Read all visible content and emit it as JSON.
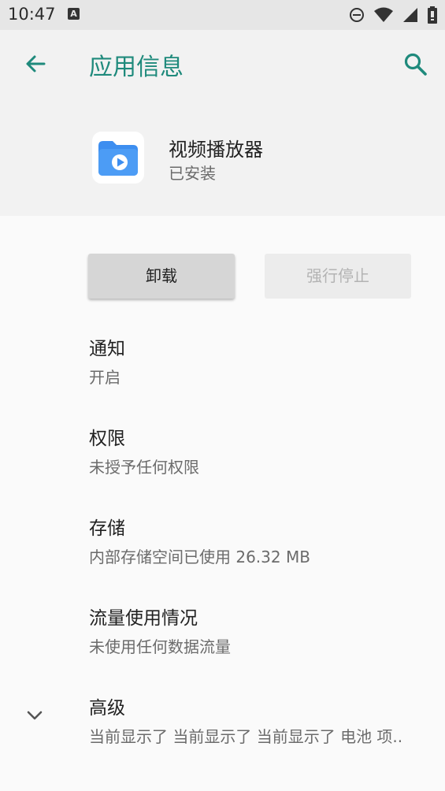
{
  "status_bar": {
    "time": "10:47",
    "notification_icon_letter": "A",
    "icons": [
      "dnd-icon",
      "wifi-icon",
      "signal-icon",
      "battery-icon"
    ]
  },
  "toolbar": {
    "title": "应用信息",
    "back_icon": "arrow-left-icon",
    "search_icon": "search-icon",
    "accent_color": "#1f8a7c"
  },
  "app": {
    "name": "视频播放器",
    "status": "已安装",
    "icon": "video-folder-icon"
  },
  "buttons": {
    "uninstall": "卸载",
    "force_stop": "强行停止"
  },
  "settings": [
    {
      "title": "通知",
      "subtitle": "开启"
    },
    {
      "title": "权限",
      "subtitle": "未授予任何权限"
    },
    {
      "title": "存储",
      "subtitle": "内部存储空间已使用 26.32 MB"
    },
    {
      "title": "流量使用情况",
      "subtitle": "未使用任何数据流量"
    },
    {
      "title": "高级",
      "subtitle": "当前显示了 当前显示了 当前显示了 电池 项.."
    }
  ]
}
